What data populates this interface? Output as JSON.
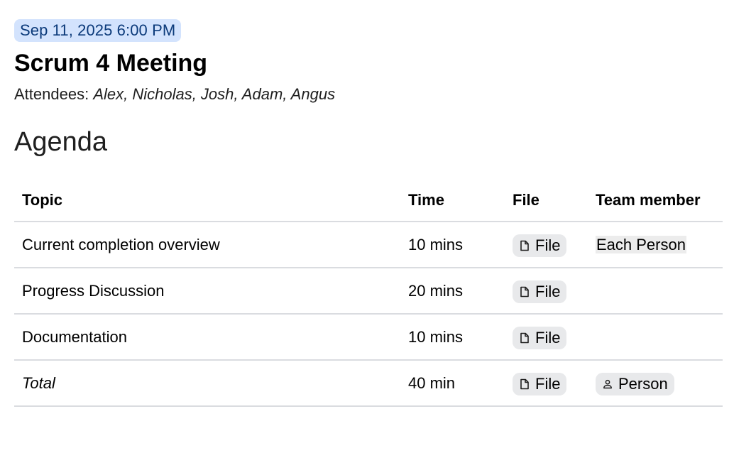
{
  "meeting": {
    "date": "Sep 11, 2025 6:00 PM",
    "title": "Scrum 4 Meeting",
    "attendees_label": "Attendees: ",
    "attendees_names": "Alex, Nicholas, Josh, Adam, Angus"
  },
  "agenda": {
    "heading": "Agenda",
    "columns": {
      "topic": "Topic",
      "time": "Time",
      "file": "File",
      "member": "Team member"
    },
    "rows": [
      {
        "topic": "Current completion overview",
        "time": "10 mins",
        "file": "File",
        "member": "Each Person"
      },
      {
        "topic": "Progress Discussion",
        "time": "20 mins",
        "file": "File",
        "member": ""
      },
      {
        "topic": "Documentation",
        "time": "10 mins",
        "file": "File",
        "member": ""
      },
      {
        "topic": "Total",
        "time": "40 min",
        "file": "File",
        "member": "Person"
      }
    ]
  },
  "icons": {
    "file_chip": "file-icon",
    "person_chip": "person-icon"
  },
  "colors": {
    "date_chip_bg": "#d3e3fd",
    "date_chip_text": "#0b3a7a",
    "chip_bg": "#e8e9eb",
    "divider": "#dadce0"
  }
}
